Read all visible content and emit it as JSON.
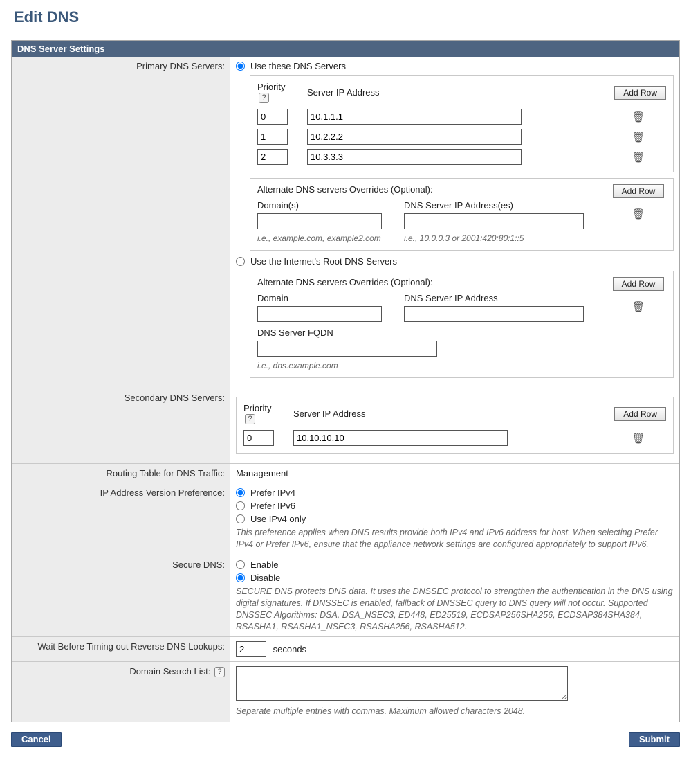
{
  "page_title": "Edit DNS",
  "panel_title": "DNS Server Settings",
  "labels": {
    "primary": "Primary DNS Servers:",
    "secondary": "Secondary DNS Servers:",
    "routing": "Routing Table for DNS Traffic:",
    "ipversion": "IP Address Version Preference:",
    "securedns": "Secure DNS:",
    "reverse_timeout": "Wait Before Timing out Reverse DNS Lookups:",
    "domain_search": "Domain Search List:"
  },
  "common": {
    "add_row": "Add Row",
    "priority": "Priority",
    "server_ip": "Server IP Address",
    "seconds": "seconds",
    "help": "?"
  },
  "primary": {
    "radio_use_these": "Use these DNS Servers",
    "radio_root": "Use the Internet's Root DNS Servers",
    "selected": "use_these",
    "rows": [
      {
        "priority": "0",
        "ip": "10.1.1.1"
      },
      {
        "priority": "1",
        "ip": "10.2.2.2"
      },
      {
        "priority": "2",
        "ip": "10.3.3.3"
      }
    ],
    "alt1": {
      "title": "Alternate DNS servers Overrides (Optional):",
      "col_domain": "Domain(s)",
      "col_ip": "DNS Server IP Address(es)",
      "hint_domain": "i.e., example.com, example2.com",
      "hint_ip": "i.e., 10.0.0.3 or 2001:420:80:1::5",
      "rows": [
        {
          "domain": "",
          "ip": ""
        }
      ]
    },
    "alt2": {
      "title": "Alternate DNS servers Overrides (Optional):",
      "col_domain": "Domain",
      "col_ip": "DNS Server IP Address",
      "col_fqdn": "DNS Server FQDN",
      "hint_fqdn": "i.e., dns.example.com",
      "rows": [
        {
          "domain": "",
          "ip": "",
          "fqdn": ""
        }
      ]
    }
  },
  "secondary": {
    "rows": [
      {
        "priority": "0",
        "ip": "10.10.10.10"
      }
    ]
  },
  "routing": {
    "value": "Management"
  },
  "ipversion": {
    "opt1": "Prefer IPv4",
    "opt2": "Prefer IPv6",
    "opt3": "Use IPv4 only",
    "selected": "opt1",
    "note": "This preference applies when DNS results provide both IPv4 and IPv6 address for host. When selecting Prefer IPv4 or Prefer IPv6, ensure that the appliance network settings are configured appropriately to support IPv6."
  },
  "securedns": {
    "opt_enable": "Enable",
    "opt_disable": "Disable",
    "selected": "disable",
    "note": "SECURE DNS protects DNS data. It uses the DNSSEC protocol to strengthen the authentication in the DNS using digital signatures. If DNSSEC is enabled, fallback of DNSSEC query to DNS query will not occur. Supported DNSSEC Algorithms: DSA, DSA_NSEC3, ED448, ED25519, ECDSAP256SHA256, ECDSAP384SHA384, RSASHA1, RSASHA1_NSEC3, RSASHA256, RSASHA512."
  },
  "reverse_timeout": {
    "value": "2"
  },
  "domain_search": {
    "value": "",
    "hint": "Separate multiple entries with commas. Maximum allowed characters 2048."
  },
  "footer": {
    "cancel": "Cancel",
    "submit": "Submit"
  }
}
